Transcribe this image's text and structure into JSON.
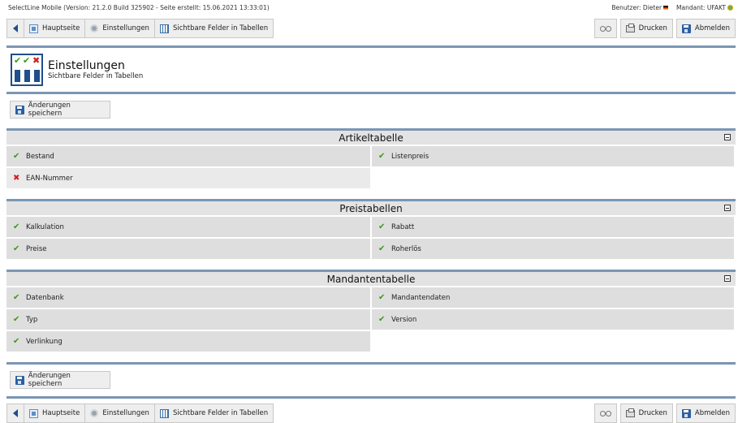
{
  "topinfo": {
    "version_text": "SelectLine Mobile (Version: 21.2.0 Build 325902 - Seite erstellt: 15.06.2021 13:33:01)",
    "user_text": "Benutzer: Dieter",
    "mandant_text": "Mandant: UFAKT"
  },
  "nav": {
    "home": "Hauptseite",
    "settings": "Einstellungen",
    "visible_fields": "Sichtbare Felder in Tabellen",
    "print": "Drucken",
    "logout": "Abmelden"
  },
  "page": {
    "title": "Einstellungen",
    "subtitle": "Sichtbare Felder in Tabellen",
    "save_label": "Änderungen speichern"
  },
  "colors": {
    "accent": "#7b96b3",
    "check": "#3a9a16",
    "cross": "#d02020"
  },
  "sections": [
    {
      "title": "Artikeltabelle",
      "fields": [
        {
          "label": "Bestand",
          "enabled": true
        },
        {
          "label": "Listenpreis",
          "enabled": true
        },
        {
          "label": "EAN-Nummer",
          "enabled": false
        }
      ]
    },
    {
      "title": "Preistabellen",
      "fields": [
        {
          "label": "Kalkulation",
          "enabled": true
        },
        {
          "label": "Rabatt",
          "enabled": true
        },
        {
          "label": "Preise",
          "enabled": true
        },
        {
          "label": "Roherlös",
          "enabled": true
        }
      ]
    },
    {
      "title": "Mandantentabelle",
      "fields": [
        {
          "label": "Datenbank",
          "enabled": true
        },
        {
          "label": "Mandantendaten",
          "enabled": true
        },
        {
          "label": "Typ",
          "enabled": true
        },
        {
          "label": "Version",
          "enabled": true
        },
        {
          "label": "Verlinkung",
          "enabled": true
        }
      ]
    }
  ]
}
